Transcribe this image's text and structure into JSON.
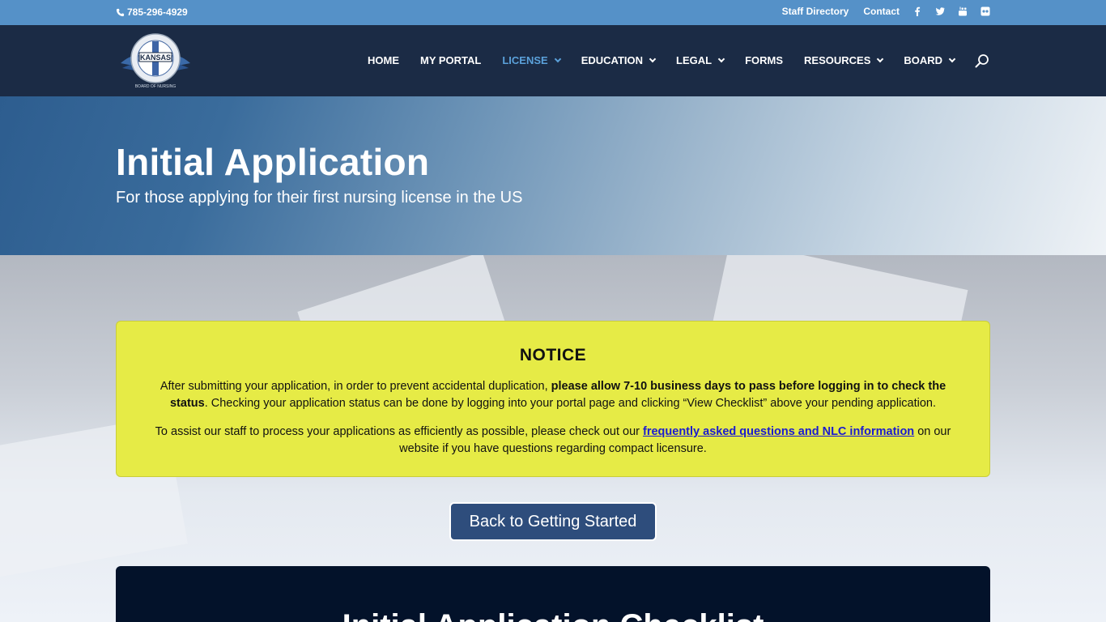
{
  "topbar": {
    "phone": "785-296-4929",
    "links": [
      "Staff Directory",
      "Contact"
    ],
    "social_icons": [
      "facebook-icon",
      "twitter-icon",
      "youtube-icon",
      "flickr-icon"
    ]
  },
  "logo": {
    "top_text": "KANSAS",
    "bottom_text": "BOARD OF NURSING"
  },
  "nav": {
    "items": [
      {
        "label": "HOME",
        "dropdown": false,
        "active": false
      },
      {
        "label": "MY PORTAL",
        "dropdown": false,
        "active": false
      },
      {
        "label": "LICENSE",
        "dropdown": true,
        "active": true
      },
      {
        "label": "EDUCATION",
        "dropdown": true,
        "active": false
      },
      {
        "label": "LEGAL",
        "dropdown": true,
        "active": false
      },
      {
        "label": "FORMS",
        "dropdown": false,
        "active": false
      },
      {
        "label": "RESOURCES",
        "dropdown": true,
        "active": false
      },
      {
        "label": "BOARD",
        "dropdown": true,
        "active": false
      }
    ],
    "active_color": "#5ba1da"
  },
  "hero": {
    "title": "Initial Application",
    "subtitle": "For those applying for their first nursing license in the US"
  },
  "notice": {
    "heading": "NOTICE",
    "p1_before": "After submitting your application, in order to prevent accidental duplication, ",
    "p1_bold": "please allow 7-10 business days to pass before logging in to check the status",
    "p1_after": ". Checking your application status can be done by logging into your portal page and clicking “View Checklist” above your pending application.",
    "p2_before": "To assist our staff to process your applications as efficiently as possible, please check out our ",
    "p2_link": "frequently asked questions and NLC information",
    "p2_after": " on our website if you have questions regarding compact licensure.",
    "bg_color": "#e6eb46"
  },
  "button": {
    "label": "Back to Getting Started"
  },
  "checklist": {
    "title": "Initial Application Checklist"
  },
  "colors": {
    "topbar": "#5591c8",
    "header": "#1b2b45",
    "button": "#2e4d7c",
    "panel": "#03122a"
  }
}
